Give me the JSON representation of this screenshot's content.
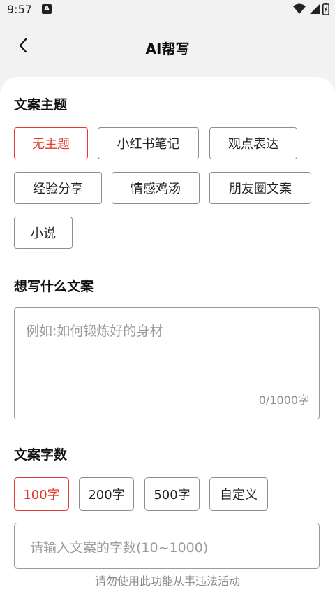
{
  "status_bar": {
    "time": "9:57",
    "notification_glyph": "A",
    "icons": [
      "wifi-icon",
      "signal-icon",
      "battery-icon"
    ]
  },
  "header": {
    "back_icon": "chevron-left-icon",
    "title": "AI帮写"
  },
  "topic_section": {
    "title": "文案主题",
    "options": [
      "无主题",
      "小红书笔记",
      "观点表达",
      "经验分享",
      "情感鸡汤",
      "朋友圈文案",
      "小说"
    ],
    "selected": "无主题"
  },
  "content_section": {
    "title": "想写什么文案",
    "placeholder": "例如:如何锻炼好的身材",
    "counter": "0/1000字"
  },
  "wordcount_section": {
    "title": "文案字数",
    "options": [
      "100字",
      "200字",
      "500字",
      "自定义"
    ],
    "selected": "100字",
    "input_placeholder": "请输入文案的字数(10~1000)"
  },
  "disclaimer": "请勿使用此功能从事违法活动",
  "colors": {
    "accent": "#e33a2f",
    "border": "#8e8e8e",
    "placeholder": "#9b9b9b",
    "background": "#f2f2f2"
  }
}
